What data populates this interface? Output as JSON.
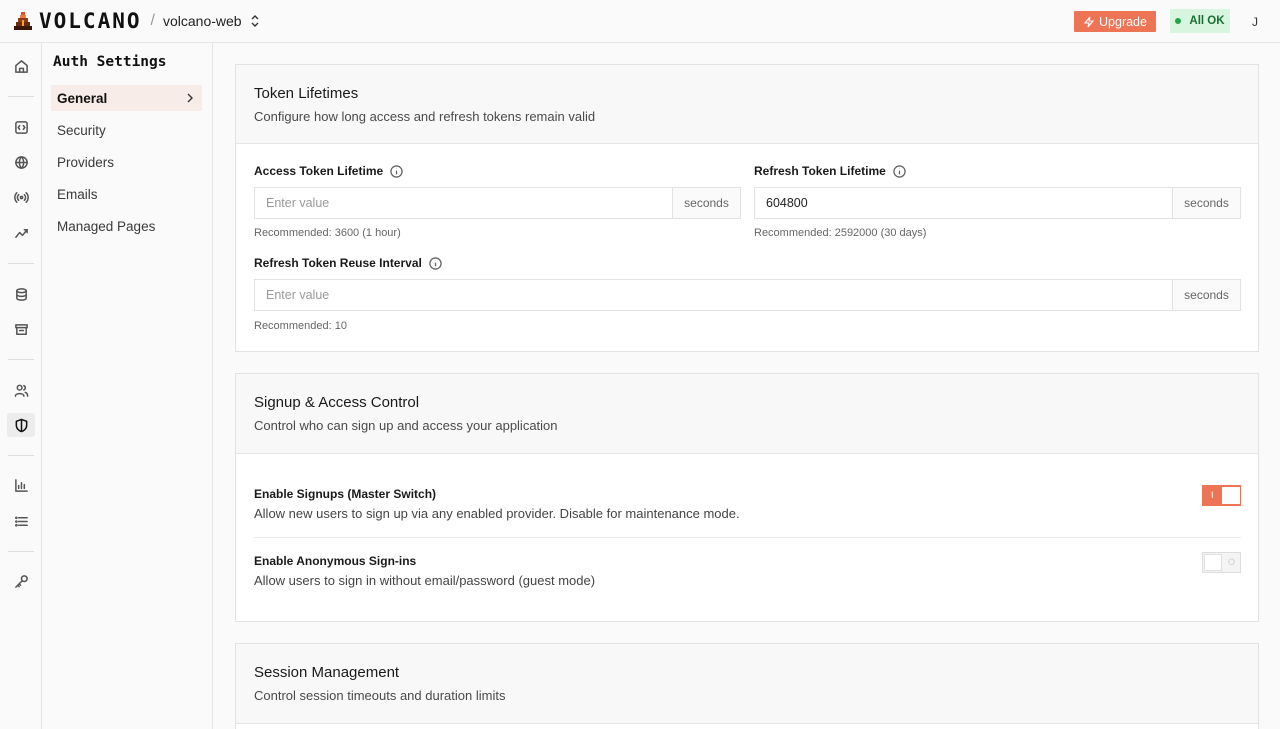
{
  "header": {
    "brand": "VOLCANO",
    "project": "volcano-web",
    "upgrade_label": "Upgrade",
    "status_label": "All OK",
    "avatar_initial": "J",
    "accent": "#ee7456"
  },
  "rail": {
    "icons": [
      "home-icon",
      "code-icon",
      "globe-icon",
      "broadcast-icon",
      "analytics-icon",
      "database-icon",
      "archive-icon",
      "users-icon",
      "shield-icon",
      "bar-chart-icon",
      "list-icon",
      "key-icon"
    ],
    "active": "shield-icon"
  },
  "sidebar": {
    "title": "Auth Settings",
    "items": [
      {
        "label": "General"
      },
      {
        "label": "Security"
      },
      {
        "label": "Providers"
      },
      {
        "label": "Emails"
      },
      {
        "label": "Managed Pages"
      }
    ]
  },
  "token_lifetimes": {
    "title": "Token Lifetimes",
    "subtitle": "Configure how long access and refresh tokens remain valid",
    "access": {
      "label": "Access Token Lifetime",
      "placeholder": "Enter value",
      "value": "",
      "unit": "seconds",
      "hint": "Recommended: 3600 (1 hour)"
    },
    "refresh": {
      "label": "Refresh Token Lifetime",
      "placeholder": "Enter value",
      "value": "604800",
      "unit": "seconds",
      "hint": "Recommended: 2592000 (30 days)"
    },
    "reuse": {
      "label": "Refresh Token Reuse Interval",
      "placeholder": "Enter value",
      "value": "",
      "unit": "seconds",
      "hint": "Recommended: 10"
    }
  },
  "signup": {
    "title": "Signup & Access Control",
    "subtitle": "Control who can sign up and access your application",
    "rows": [
      {
        "title": "Enable Signups (Master Switch)",
        "desc": "Allow new users to sign up via any enabled provider. Disable for maintenance mode.",
        "on": true,
        "mark": "I"
      },
      {
        "title": "Enable Anonymous Sign-ins",
        "desc": "Allow users to sign in without email/password (guest mode)",
        "on": false,
        "mark": "O"
      }
    ]
  },
  "session": {
    "title": "Session Management",
    "subtitle": "Control session timeouts and duration limits"
  }
}
